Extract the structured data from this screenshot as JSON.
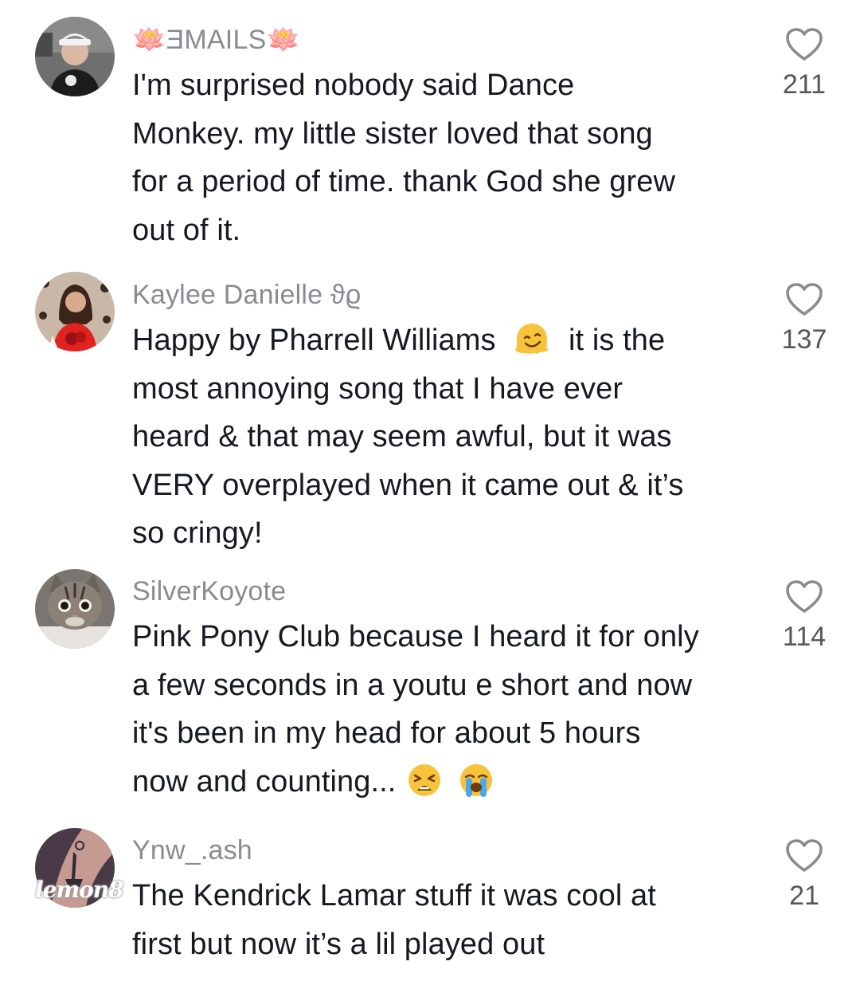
{
  "comments": [
    {
      "username": "🪷ƎMAILS🪷",
      "lines": [
        "I'm surprised nobody said Dance",
        "Monkey. my little sister loved that song",
        "for a period of time. thank God she grew",
        "out of it."
      ],
      "likes": "211",
      "avatar_icon": "avatar-boy-with-cap"
    },
    {
      "username": "Kaylee Danielle ϑϱ",
      "lines": [
        "Happy by Pharrell Williams",
        "it is the",
        "most annoying song that I have ever",
        "heard & that may seem awful, but it was",
        "VERY overplayed when it came out & it’s",
        "so cringy!"
      ],
      "likes": "137",
      "avatar_icon": "avatar-woman-with-roses",
      "emoji_icon": "melting-face-emoji"
    },
    {
      "username": "SilverKoyote",
      "lines": [
        "Pink Pony Club because I heard it for only",
        "a few seconds in a youtu e short and now",
        "it's been in my head for about 5 hours",
        "now and counting..."
      ],
      "likes": "114",
      "avatar_icon": "avatar-tabby-cat",
      "emoji_icons": [
        "tired-face-emoji",
        "loudly-crying-face-emoji"
      ]
    },
    {
      "username": "Ynw_.ash",
      "lines": [
        "The Kendrick Lamar stuff it was cool at",
        "first but now it’s a lil played out"
      ],
      "likes": "21",
      "avatar_icon": "avatar-tattooed-arm"
    }
  ],
  "like_icon": "heart-outline-icon",
  "watermark": "lemon8",
  "colors": {
    "text": "#161823",
    "username": "#8a8b91",
    "like_count": "#555660",
    "heart_stroke": "#8a8b91"
  }
}
